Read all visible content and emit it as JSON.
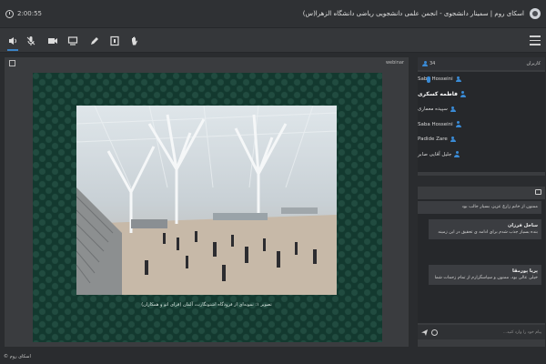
{
  "header": {
    "timer": "2:00:55",
    "title": "اسکای روم | سمینار دانشجوی - انجمن علمی دانشجویی ریاضی دانشگاه الزهرا(س)"
  },
  "toolbar": {
    "tools": [
      {
        "icon": "speaker-icon",
        "label": "speaker"
      },
      {
        "icon": "mic-off-icon",
        "label": "microphone"
      },
      {
        "icon": "camera-icon",
        "label": "camera"
      },
      {
        "icon": "screen-share-icon",
        "label": "share screen"
      },
      {
        "icon": "pen-icon",
        "label": "whiteboard"
      },
      {
        "icon": "presentation-icon",
        "label": "presentation"
      },
      {
        "icon": "raise-hand-icon",
        "label": "raise hand"
      }
    ]
  },
  "webinar": {
    "label": "webinar",
    "caption": "تصویر ۱: نمونه‌ای از فرودگاه اشتوتگارت، آلمان (فرای اتو و همکاران)"
  },
  "participants": {
    "title": "کاربران",
    "count": "34",
    "list": [
      {
        "name": "Saba Hosseini",
        "bold": false,
        "mic": true
      },
      {
        "name": "فاطمه کسکری",
        "bold": true,
        "mic": false
      },
      {
        "name": "سپیده معماری",
        "bold": false,
        "mic": false
      },
      {
        "name": "Saba Hosseini",
        "bold": false,
        "mic": false
      },
      {
        "name": "Padide Zare",
        "bold": false,
        "mic": false
      },
      {
        "name": "جلیل آقایی صابر",
        "bold": false,
        "mic": false
      }
    ]
  },
  "chat": {
    "messages": [
      {
        "name": "",
        "text": "ممنون از خانم زارع عزیز، بسیار جالب بود"
      },
      {
        "name": "ساحل فرزان",
        "text": "بنده بسیار جذب شدم برای ادامه ی تحقیق در این زمینه"
      },
      {
        "name": "پریا پورمقا",
        "text": "خیلی عالی بود. ممنون و سپاسگزارم از تمام زحمات شما"
      }
    ],
    "placeholder": "پیام خود را وارد کنید..."
  },
  "footer": {
    "brand": "© اسکای روم"
  },
  "colors": {
    "accent": "#3a8bd6",
    "panel": "#3a3c3f",
    "stage": "#13392f"
  }
}
